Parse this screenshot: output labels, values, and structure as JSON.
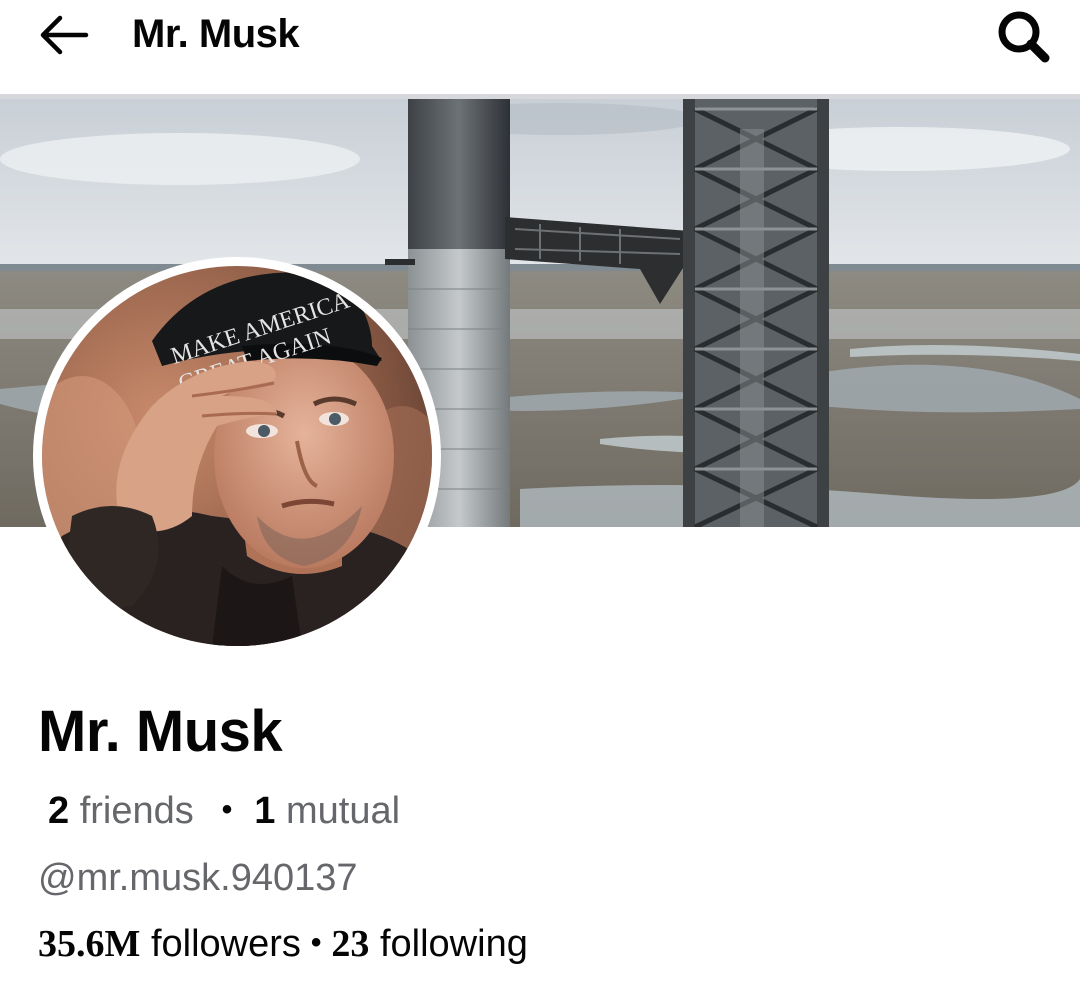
{
  "header": {
    "title": "Mr. Musk",
    "back_icon": "arrow-left-icon",
    "search_icon": "search-icon"
  },
  "cover_photo": {
    "description_icon": "cover-photo-image"
  },
  "avatar": {
    "cap_text_line1": "MAKE AMERICA",
    "cap_text_line2": "GREAT AGAIN"
  },
  "profile": {
    "name": "Mr. Musk",
    "friends_count": "2",
    "friends_label": "friends",
    "mutual_count": "1",
    "mutual_label": "mutual",
    "username": "@mr.musk.940137",
    "followers_count": "35.6M",
    "followers_label": "followers",
    "following_count": "23",
    "following_label": "following"
  },
  "colors": {
    "text_primary": "#050505",
    "text_secondary": "#65676b",
    "divider": "#d6d8dc"
  }
}
